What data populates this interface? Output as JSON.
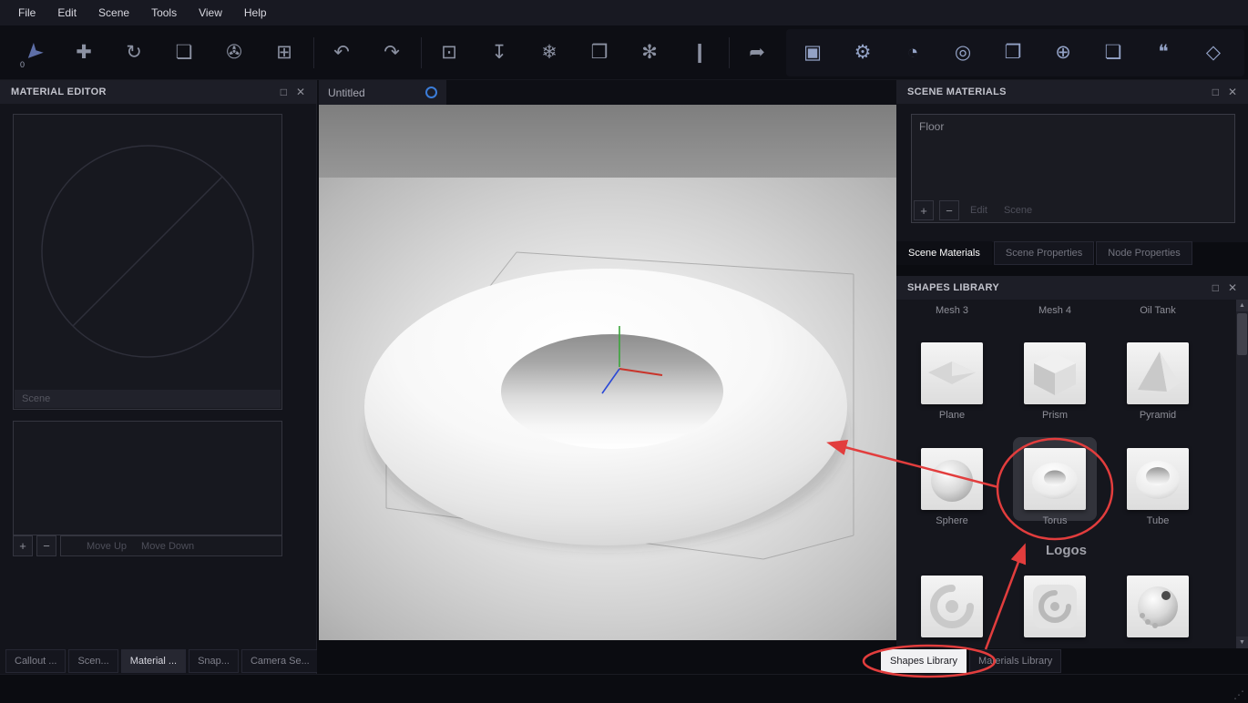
{
  "menu": {
    "items": [
      "File",
      "Edit",
      "Scene",
      "Tools",
      "View",
      "Help"
    ]
  },
  "toolbar": {
    "badge": "0",
    "left": [
      {
        "name": "pointer-tool-icon",
        "glyph": "➤"
      },
      {
        "name": "move-tool-icon",
        "glyph": "✚"
      },
      {
        "name": "rotate-tool-icon",
        "glyph": "↻"
      },
      {
        "name": "duplicate-icon",
        "glyph": "❏"
      },
      {
        "name": "video-camera-icon",
        "glyph": "✇"
      },
      {
        "name": "add-callout-icon",
        "glyph": "⊞"
      },
      {
        "name": "undo-icon",
        "glyph": "↶"
      },
      {
        "name": "redo-icon",
        "glyph": "↷"
      },
      {
        "name": "frame-view-icon",
        "glyph": "⊡"
      },
      {
        "name": "drop-to-floor-icon",
        "glyph": "↧"
      },
      {
        "name": "snowflake-icon",
        "glyph": "❄"
      },
      {
        "name": "link-materials-icon",
        "glyph": "❒"
      },
      {
        "name": "pattern-icon",
        "glyph": "✻"
      },
      {
        "name": "material-bottle-icon",
        "glyph": "❙"
      },
      {
        "name": "share-icon",
        "glyph": "➦"
      }
    ],
    "right": [
      {
        "name": "scene-nodes-icon",
        "glyph": "▣"
      },
      {
        "name": "settings-gear-icon",
        "glyph": "⚙"
      },
      {
        "name": "render-icon",
        "glyph": "◔"
      },
      {
        "name": "capture-icon",
        "glyph": "◎"
      },
      {
        "name": "library-folder-icon",
        "glyph": "❐"
      },
      {
        "name": "environment-icon",
        "glyph": "⊕"
      },
      {
        "name": "backplate-icon",
        "glyph": "❏"
      },
      {
        "name": "annotation-icon",
        "glyph": "❝"
      },
      {
        "name": "geometry-cube-icon",
        "glyph": "◇"
      }
    ]
  },
  "window": {
    "float_glyph": "□",
    "close_glyph": "✕"
  },
  "material_editor": {
    "title": "MATERIAL EDITOR",
    "scene_label": "Scene",
    "plus": "+",
    "minus": "−",
    "move_up": "Move Up",
    "move_down": "Move Down"
  },
  "viewport": {
    "tab_label": "Untitled"
  },
  "scene_materials": {
    "title": "SCENE MATERIALS",
    "items": [
      "Floor"
    ],
    "plus": "+",
    "minus": "−",
    "edit_label": "Edit",
    "scene_button_label": "Scene",
    "tabs": [
      "Scene Materials",
      "Scene Properties",
      "Node Properties"
    ]
  },
  "shapes_library": {
    "title": "SHAPES LIBRARY",
    "hidden_row_labels": [
      "Mesh 3",
      "Mesh 4",
      "Oil Tank"
    ],
    "shapes": [
      "Plane",
      "Prism",
      "Pyramid",
      "Sphere",
      "Torus",
      "Tube"
    ],
    "section_header": "Logos",
    "logo_icons": [
      "swirl-logo-icon",
      "swirl-plaque-logo-icon",
      "studded-ball-logo-icon"
    ]
  },
  "bottom_tabs": {
    "left": [
      "Callout ...",
      "Scen...",
      "Material ...",
      "Snap...",
      "Camera Se..."
    ],
    "right": [
      "Shapes Library",
      "Materials Library"
    ]
  },
  "scrollbar": {
    "up": "▲",
    "down": "▼"
  },
  "status_bar": {
    "grip": "⋰"
  },
  "colors": {
    "annotation_red": "#e23d3d",
    "tab_indicator_blue": "#3b7cd8",
    "axis_x": "#c9342a",
    "axis_y": "#3aa53a",
    "axis_z": "#2b49d6"
  }
}
